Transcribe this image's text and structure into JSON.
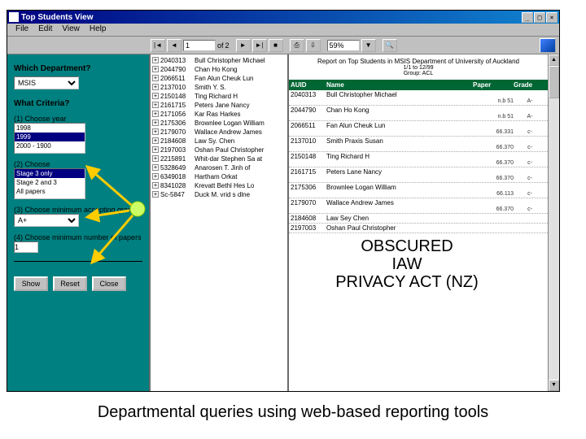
{
  "window": {
    "title": "Top Students View",
    "menus": [
      "File",
      "Edit",
      "View",
      "Help"
    ],
    "buttons": {
      "min": "_",
      "max": "□",
      "close": "×"
    }
  },
  "toolbar": {
    "nav_first": "|◄",
    "nav_prev": "◄",
    "page": "1",
    "of_label": "of",
    "total": "2",
    "nav_next": "►",
    "nav_last": "►|",
    "stop": "■",
    "print": "⎙",
    "export": "⇩",
    "zoom": "59%",
    "zoom_dd": "▼",
    "find": "🔍"
  },
  "filters": {
    "q1": "Which Department?",
    "dept": "MSIS",
    "q2": "What Criteria?",
    "lbl_year": "(1) Choose year",
    "years": [
      "1998",
      "1999",
      "2000 - 1900"
    ],
    "year_selected": "1999",
    "lbl_stage": "(2) Choose",
    "stages": [
      "Stage 3 only",
      "Stage 2 and 3",
      "All papers"
    ],
    "stage_selected": "Stage 3 only",
    "lbl_grade": "(3) Choose minimum accepting grade",
    "grade": "A+",
    "lbl_min": "(4) Choose minimum number of papers",
    "min_papers": "1",
    "btn_show": "Show",
    "btn_reset": "Reset",
    "btn_close": "Close"
  },
  "tree": [
    {
      "id": "2040313",
      "name": "Bull Christopher Michael"
    },
    {
      "id": "2044790",
      "name": "Chan Ho Kong"
    },
    {
      "id": "2066511",
      "name": "Fan Alun Cheuk Lun"
    },
    {
      "id": "2137010",
      "name": "Smith Y. S."
    },
    {
      "id": "2150148",
      "name": "Ting Richard H"
    },
    {
      "id": "2161715",
      "name": "Peters Jane Nancy"
    },
    {
      "id": "2171056",
      "name": "Kar Ras Harkes"
    },
    {
      "id": "2175306",
      "name": "Brownlee Logan William"
    },
    {
      "id": "2179070",
      "name": "Wallace Andrew James"
    },
    {
      "id": "2184608",
      "name": "Law Sy. Chen"
    },
    {
      "id": "2197003",
      "name": "Oshan Paul Christopher"
    },
    {
      "id": "2215891",
      "name": "Whit-dar Stephen Sa at"
    },
    {
      "id": "5328649",
      "name": "Anarosen T. Jinh of"
    },
    {
      "id": "6349018",
      "name": "Hartham Orkat"
    },
    {
      "id": "8341028",
      "name": "Krevatt Bethl Hes Lo"
    },
    {
      "id": "Sc-5847",
      "name": "Duck M. vrid s dlne"
    }
  ],
  "report": {
    "title": "Report on Top Students in MSIS Department of University of Auckland",
    "subtitle": "1/1 to 12/99",
    "subtitle2": "Group: ACL",
    "cols": {
      "c1": "AUID",
      "c2": "Name",
      "c3": "Paper",
      "c4": "Grade"
    },
    "rows": [
      {
        "id": "2040313",
        "name": "Bull Christopher Michael",
        "paper": "n.b 51",
        "grade": "A-"
      },
      {
        "id": "2044790",
        "name": "Chan Ho Kong",
        "paper": "n.b 51",
        "grade": "A-"
      },
      {
        "id": "2066511",
        "name": "Fan Alun Cheuk Lun",
        "paper": "66.331",
        "grade": "c-"
      },
      {
        "id": "2137010",
        "name": "Smith Praxis Susan",
        "paper": "66.370",
        "grade": "c-"
      },
      {
        "id": "2150148",
        "name": "Ting Richard H",
        "paper": "66.370",
        "grade": "c-"
      },
      {
        "id": "2161715",
        "name": "Peters Lane Nancy",
        "paper": "66.370",
        "grade": "c-"
      },
      {
        "id": "2175306",
        "name": "Brownlee Logan William",
        "paper": "66.113",
        "grade": "c-"
      },
      {
        "id": "2179070",
        "name": "Wallace Andrew James",
        "paper": "66.370",
        "grade": "c-"
      },
      {
        "id": "2184608",
        "name": "Law Sey Chen",
        "paper": "",
        "grade": ""
      },
      {
        "id": "2197003",
        "name": "Oshan Paul Christopher",
        "paper": "",
        "grade": ""
      }
    ]
  },
  "overlay": {
    "l1": "OBSCURED",
    "l2": "IAW",
    "l3": "PRIVACY ACT (NZ)"
  },
  "caption": "Departmental queries using web-based reporting tools"
}
